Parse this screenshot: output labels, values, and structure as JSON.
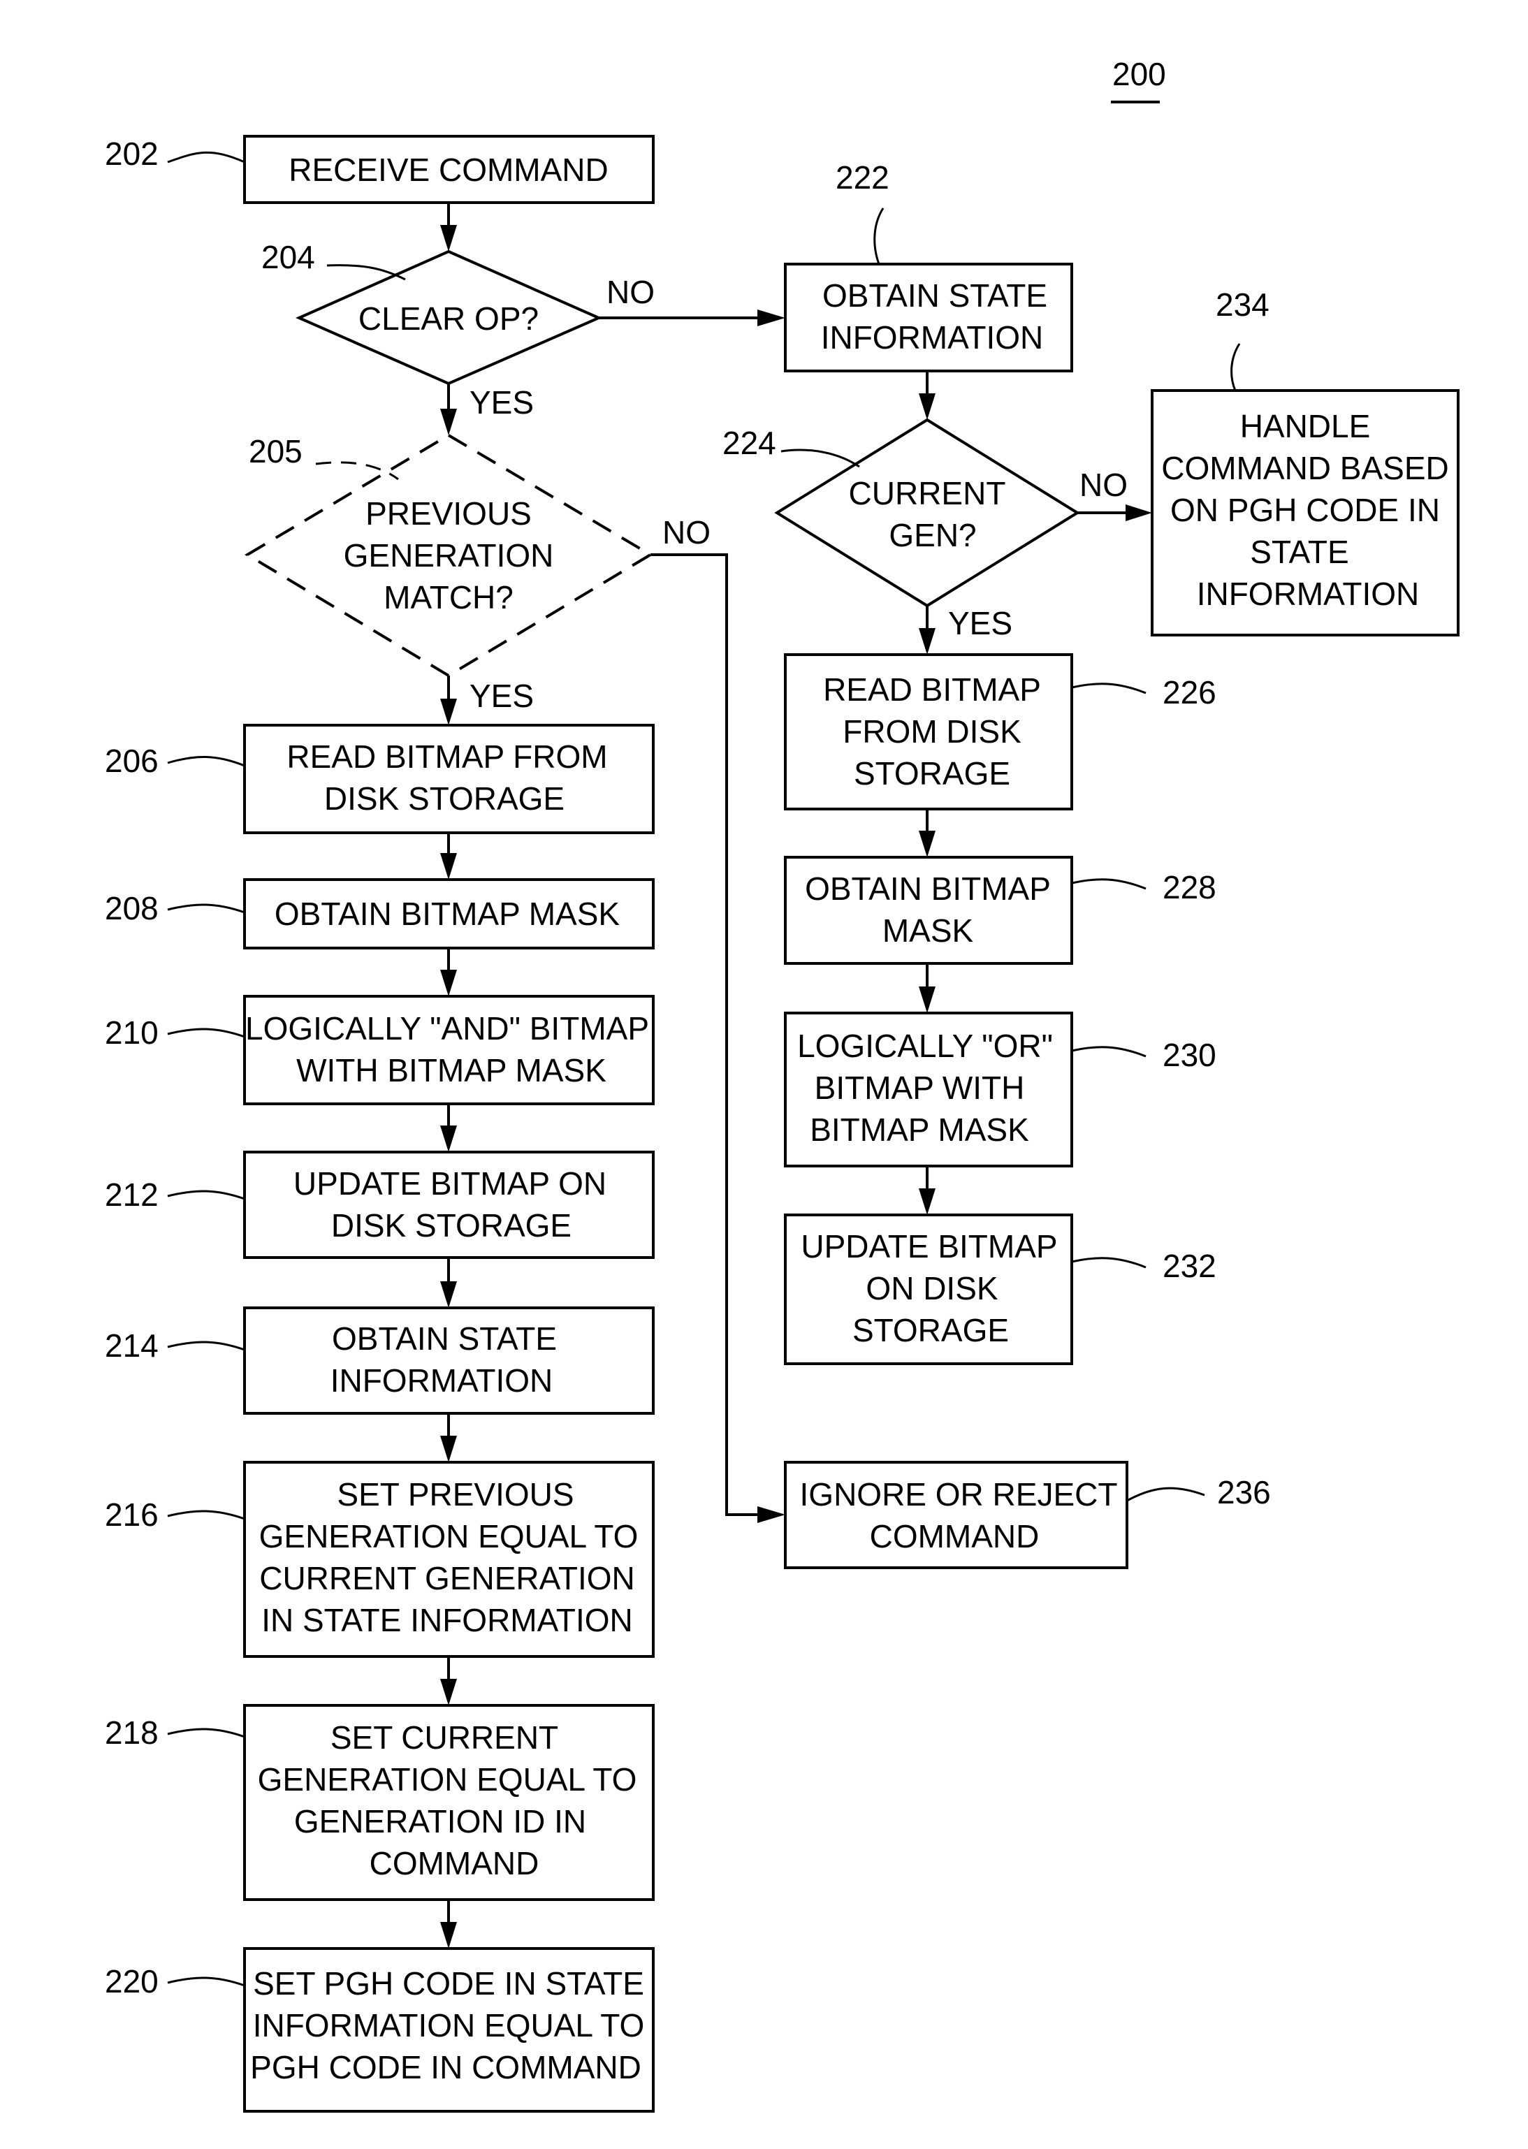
{
  "figure": {
    "label": "200"
  },
  "nodes": {
    "n202": {
      "ref": "202",
      "lines": [
        "RECEIVE COMMAND"
      ]
    },
    "n204": {
      "ref": "204",
      "lines": [
        "CLEAR OP?"
      ]
    },
    "n205": {
      "ref": "205",
      "lines": [
        "PREVIOUS",
        "GENERATION",
        "MATCH?"
      ]
    },
    "n206": {
      "ref": "206",
      "lines": [
        "READ BITMAP FROM",
        "DISK STORAGE"
      ]
    },
    "n208": {
      "ref": "208",
      "lines": [
        "OBTAIN BITMAP MASK"
      ]
    },
    "n210": {
      "ref": "210",
      "lines": [
        "LOGICALLY \"AND\" BITMAP",
        "WITH BITMAP MASK"
      ]
    },
    "n212": {
      "ref": "212",
      "lines": [
        "UPDATE BITMAP ON",
        "DISK STORAGE"
      ]
    },
    "n214": {
      "ref": "214",
      "lines": [
        "OBTAIN STATE",
        "INFORMATION"
      ]
    },
    "n216": {
      "ref": "216",
      "lines": [
        "SET PREVIOUS",
        "GENERATION EQUAL TO",
        "CURRENT GENERATION",
        "IN STATE INFORMATION"
      ]
    },
    "n218": {
      "ref": "218",
      "lines": [
        "SET CURRENT",
        "GENERATION EQUAL TO",
        "GENERATION ID IN",
        "COMMAND"
      ]
    },
    "n220": {
      "ref": "220",
      "lines": [
        "SET PGH CODE IN STATE",
        "INFORMATION EQUAL TO",
        "PGH CODE IN COMMAND"
      ]
    },
    "n222": {
      "ref": "222",
      "lines": [
        "OBTAIN STATE",
        "INFORMATION"
      ]
    },
    "n224": {
      "ref": "224",
      "lines": [
        "CURRENT",
        "GEN?"
      ]
    },
    "n226": {
      "ref": "226",
      "lines": [
        "READ BITMAP",
        "FROM DISK",
        "STORAGE"
      ]
    },
    "n228": {
      "ref": "228",
      "lines": [
        "OBTAIN BITMAP",
        "MASK"
      ]
    },
    "n230": {
      "ref": "230",
      "lines": [
        "LOGICALLY \"OR\"",
        "BITMAP WITH",
        "BITMAP MASK"
      ]
    },
    "n232": {
      "ref": "232",
      "lines": [
        "UPDATE BITMAP",
        "ON DISK",
        "STORAGE"
      ]
    },
    "n234": {
      "ref": "234",
      "lines": [
        "HANDLE",
        "COMMAND BASED",
        "ON PGH CODE IN",
        "STATE",
        "INFORMATION"
      ]
    },
    "n236": {
      "ref": "236",
      "lines": [
        "IGNORE OR REJECT",
        "COMMAND"
      ]
    }
  },
  "edge_labels": {
    "e204_no": "NO",
    "e204_yes": "YES",
    "e205_no": "NO",
    "e205_yes": "YES",
    "e224_no": "NO",
    "e224_yes": "YES"
  }
}
